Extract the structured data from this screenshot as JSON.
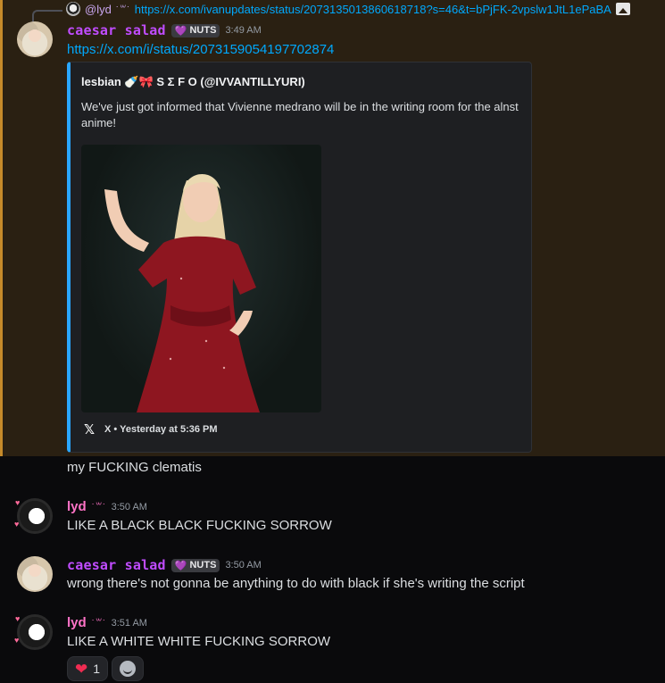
{
  "reply": {
    "author": "@lyd",
    "emoticon": "˙꒳˙",
    "text": "https://x.com/ivanupdates/status/2073135013860618718?s=46&t=bPjFK-2vpslw1JtL1ePaBA"
  },
  "messages": [
    {
      "author": "caesar salad",
      "tag": "NUTS",
      "time": "3:49 AM",
      "link": "https://x.com/i/status/2073159054197702874",
      "embed": {
        "author": "lesbian 🍼🎀 S Σ F O (@IVVANTILLYURI)",
        "description": "We've just got informed that Vivienne medrano will be in the writing room for the alnst anime!",
        "footer": "X • Yesterday at 5:36 PM",
        "footer_icon": "x-logo-icon",
        "accent": "#2aa6ff"
      }
    },
    {
      "text": "my FUCKING clematis"
    },
    {
      "author": "lyd",
      "emoticon": "˙꒳˙",
      "time": "3:50 AM",
      "text": "LIKE A BLACK BLACK FUCKING SORROW"
    },
    {
      "author": "caesar salad",
      "tag": "NUTS",
      "time": "3:50 AM",
      "text": "wrong there's not gonna be anything to do with black if she's writing the script"
    },
    {
      "author": "lyd",
      "emoticon": "˙꒳˙",
      "time": "3:51 AM",
      "text": "LIKE A WHITE WHITE FUCKING SORROW",
      "reactions": [
        {
          "emoji": "❤",
          "count": "1"
        }
      ]
    }
  ],
  "colors": {
    "highlight_bg": "#2a2012",
    "highlight_border": "#c58a2a",
    "caesar_name": "#c04cff",
    "lyd_name": "#ff73c7",
    "link": "#00a8fc"
  }
}
